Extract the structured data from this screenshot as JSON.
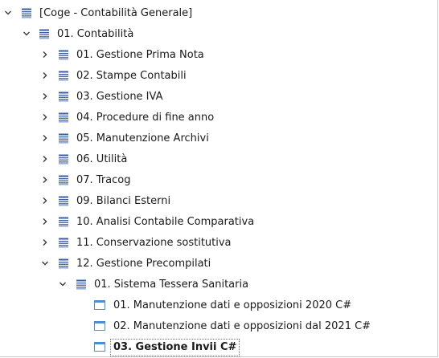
{
  "tree": {
    "root": {
      "label": "[Coge - Contabilità Generale]",
      "icon": "menu-list-icon",
      "expanded": true
    },
    "l1": {
      "label": "01. Contabilità",
      "icon": "menu-list-icon",
      "expanded": true
    },
    "l2": [
      {
        "label": "01. Gestione Prima Nota",
        "icon": "menu-list-icon",
        "expanded": false
      },
      {
        "label": "02. Stampe Contabili",
        "icon": "menu-list-icon",
        "expanded": false
      },
      {
        "label": "03. Gestione IVA",
        "icon": "menu-list-icon",
        "expanded": false
      },
      {
        "label": "04. Procedure di fine anno",
        "icon": "menu-list-icon",
        "expanded": false
      },
      {
        "label": "05. Manutenzione Archivi",
        "icon": "menu-list-icon",
        "expanded": false
      },
      {
        "label": "06. Utilità",
        "icon": "menu-list-icon",
        "expanded": false
      },
      {
        "label": "07. Tracog",
        "icon": "menu-list-icon",
        "expanded": false
      },
      {
        "label": "09. Bilanci Esterni",
        "icon": "menu-list-icon",
        "expanded": false
      },
      {
        "label": "10. Analisi Contabile Comparativa",
        "icon": "menu-list-icon",
        "expanded": false
      },
      {
        "label": "11. Conservazione sostitutiva",
        "icon": "menu-list-icon",
        "expanded": false
      },
      {
        "label": "12. Gestione Precompilati",
        "icon": "menu-list-icon",
        "expanded": true
      }
    ],
    "l3": {
      "label": "01. Sistema Tessera Sanitaria",
      "icon": "menu-list-icon",
      "expanded": true
    },
    "l4": [
      {
        "label": "01. Manutenzione dati e opposizioni 2020 C#",
        "icon": "window-icon"
      },
      {
        "label": "02. Manutenzione dati e opposizioni dal 2021 C#",
        "icon": "window-icon"
      },
      {
        "label": "03. Gestione Invii C#",
        "icon": "window-icon",
        "selected": true
      }
    ]
  },
  "colors": {
    "icon_blue": "#3b5ea8",
    "window_icon_blue": "#4a8fd6",
    "chevron": "#404040"
  }
}
